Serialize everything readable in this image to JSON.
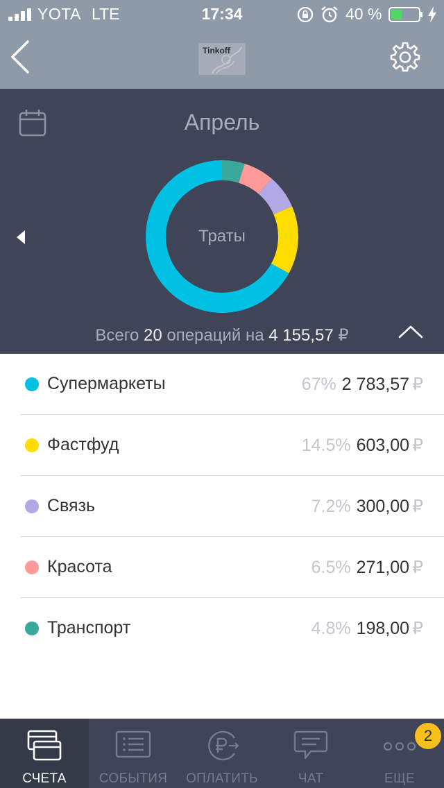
{
  "status_bar": {
    "carrier": "YOTA",
    "network": "LTE",
    "time": "17:34",
    "battery_percent": "40 %",
    "battery_level": 0.4,
    "icons": [
      "signal-icon",
      "rotation-lock-icon",
      "alarm-icon",
      "battery-icon",
      "charging-icon"
    ]
  },
  "header": {
    "logo_text": "Tinkoff",
    "icons": [
      "back-chevron-icon",
      "settings-gear-icon"
    ]
  },
  "period": {
    "month": "Апрель"
  },
  "chart_data": {
    "type": "pie",
    "center_label": "Траты",
    "categories": [
      "Супермаркеты",
      "Фастфуд",
      "Связь",
      "Красота",
      "Транспорт"
    ],
    "values": [
      67,
      14.5,
      7.2,
      6.5,
      4.8
    ],
    "colors": [
      "#00c0e4",
      "#ffdd00",
      "#b3a8e6",
      "#ff9a9a",
      "#3aa89b"
    ]
  },
  "summary": {
    "prefix": "Всего",
    "count": "20",
    "middle": "операций на",
    "total": "4 155,57",
    "currency": "₽"
  },
  "categories": [
    {
      "name": "Супермаркеты",
      "percent": "67%",
      "amount": "2 783,57",
      "currency": "₽",
      "color": "#00c0e4"
    },
    {
      "name": "Фастфуд",
      "percent": "14.5%",
      "amount": "603,00",
      "currency": "₽",
      "color": "#ffdd00"
    },
    {
      "name": "Связь",
      "percent": "7.2%",
      "amount": "300,00",
      "currency": "₽",
      "color": "#b3a8e6"
    },
    {
      "name": "Красота",
      "percent": "6.5%",
      "amount": "271,00",
      "currency": "₽",
      "color": "#ff9a9a"
    },
    {
      "name": "Транспорт",
      "percent": "4.8%",
      "amount": "198,00",
      "currency": "₽",
      "color": "#3aa89b"
    }
  ],
  "tabbar": {
    "tabs": [
      {
        "label": "СЧЕТА",
        "icon": "cards-icon",
        "active": true
      },
      {
        "label": "СОБЫТИЯ",
        "icon": "events-list-icon",
        "active": false
      },
      {
        "label": "ОПЛАТИТЬ",
        "icon": "ruble-pay-icon",
        "active": false
      },
      {
        "label": "ЧАТ",
        "icon": "chat-bubble-icon",
        "active": false
      },
      {
        "label": "ЕЩЕ",
        "icon": "more-dots-icon",
        "active": false
      }
    ],
    "more_badge": "2"
  },
  "colors": {
    "nav_background": "#8f9aa8",
    "panel_background": "#3f4556",
    "active_tab": "#353a49",
    "badge": "#f7bf1e"
  }
}
